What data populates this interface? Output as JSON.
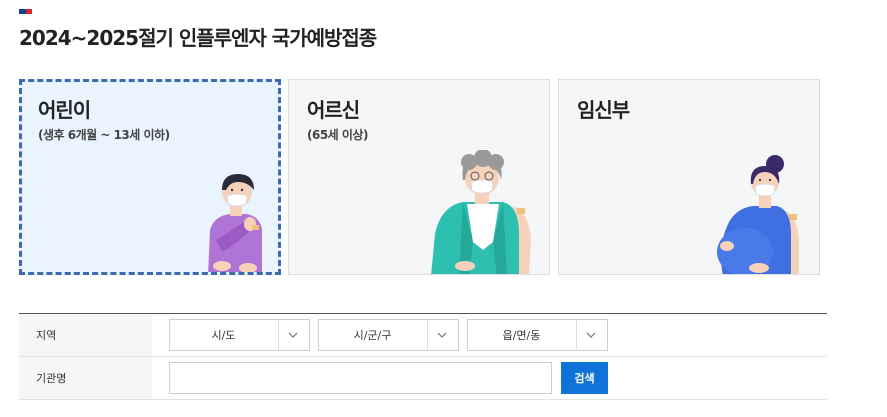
{
  "header": {
    "title": "2024~2025절기 인플루엔자 국가예방접종"
  },
  "cards": [
    {
      "title": "어린이",
      "subtitle": "(생후 6개월 ~ 13세 이하)",
      "selected": true,
      "icon": "child-illustration"
    },
    {
      "title": "어르신",
      "subtitle": "(65세 이상)",
      "selected": false,
      "icon": "elderly-illustration"
    },
    {
      "title": "임신부",
      "subtitle": "",
      "selected": false,
      "icon": "pregnant-illustration"
    }
  ],
  "form": {
    "region_label": "지역",
    "selects": [
      "시/도",
      "시/군/구",
      "읍/면/동"
    ],
    "org_label": "기관명",
    "org_value": "",
    "search_label": "검색"
  },
  "colors": {
    "accent": "#0f73d9",
    "selected_border": "#3a6bb0",
    "selected_bg": "#eaf4ff"
  }
}
